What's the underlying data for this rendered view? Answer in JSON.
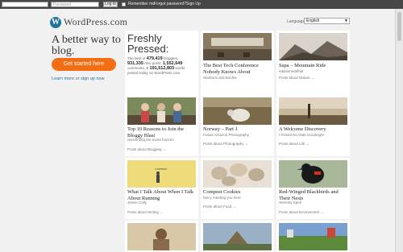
{
  "topbar": {
    "username_placeholder": "",
    "password_placeholder": "Password",
    "login_label": "Log In",
    "remember_label": "Remember me",
    "forgot_label": "Forgot password?",
    "signup_label": "Sign Up"
  },
  "brand": {
    "logo_mark": "W",
    "name": "WordPress.com"
  },
  "language": {
    "label": "Language:",
    "selected": "English"
  },
  "hero": {
    "tagline": "A better way to blog.",
    "cta_label": "Get started here",
    "learn_more": "Learn more",
    "or": "or",
    "sign_up_now": "sign up now"
  },
  "freshly_pressed": {
    "title_line1": "Freshly",
    "title_line2": "Pressed:",
    "text1": "The best of",
    "bloggers_count": "479,419",
    "text2": "bloggers,",
    "posts_count": "931,335",
    "text3": "new posts,",
    "comments_count": "1,552,649",
    "text4": "comments, &",
    "words_count": "191,512,803",
    "text5": "words posted today on WordPress.com."
  },
  "cards": [
    {
      "title": "The Best Tech Conference Nobody Knows About",
      "subtitle": "Starbuck and Bonfire",
      "posts_about": ""
    },
    {
      "title": "Sapa – Mountain Ride",
      "subtitle": "eddownedelhal",
      "posts_about": "Posts about Nature →"
    },
    {
      "title": "Top 10 Reasons to Join the Bloggy Blast",
      "subtitle": "reinventing the event horizon",
      "posts_about": "Posts about Blogging →"
    },
    {
      "title": "Norway – Part 1",
      "subtitle": "Casas Amazon Photography",
      "posts_about": "Posts about Photography →"
    },
    {
      "title": "A Welcome Discovery",
      "subtitle": "I Kissed No Date Goodnight",
      "posts_about": "Posts about Life →"
    },
    {
      "title": "What I Talk About When I Talk About Running",
      "subtitle": "Jessie Cally",
      "posts_about": "Posts about Writing →"
    },
    {
      "title": "Compost Cookies",
      "subtitle": "fancy meeting you here",
      "posts_about": "Posts about Food →"
    },
    {
      "title": "Red-Winged Blackbirds and Their Nests",
      "subtitle": "Serenity Spell",
      "posts_about": "Posts about Environment →"
    }
  ],
  "card_images": [
    {
      "alt": "conference room"
    },
    {
      "alt": "mountain landscape"
    },
    {
      "alt": "group photo"
    },
    {
      "alt": "sheep in field"
    },
    {
      "alt": "sunset sky"
    },
    {
      "alt": "yellow book cover"
    },
    {
      "alt": "cookies"
    },
    {
      "alt": "blackbird"
    }
  ],
  "book_cover_text": "a memoir"
}
